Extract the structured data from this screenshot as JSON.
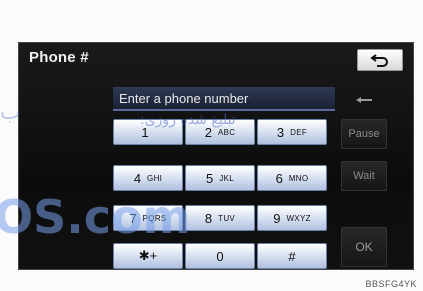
{
  "screen": {
    "title": "Phone #",
    "back_icon": "return-arrow-icon",
    "display_placeholder": "Enter a phone number",
    "backspace_icon": "backspace-arrow-icon"
  },
  "keypad": {
    "keys": [
      {
        "digit": "1",
        "letters": ""
      },
      {
        "digit": "2",
        "letters": "ABC"
      },
      {
        "digit": "3",
        "letters": "DEF"
      },
      {
        "digit": "4",
        "letters": "GHI"
      },
      {
        "digit": "5",
        "letters": "JKL"
      },
      {
        "digit": "6",
        "letters": "MNO"
      },
      {
        "digit": "7",
        "letters": "PQRS"
      },
      {
        "digit": "8",
        "letters": "TUV"
      },
      {
        "digit": "9",
        "letters": "WXYZ"
      },
      {
        "digit": "✱+",
        "letters": ""
      },
      {
        "digit": "0",
        "letters": ""
      },
      {
        "digit": "#",
        "letters": ""
      }
    ]
  },
  "side_buttons": {
    "pause": "Pause",
    "wait": "Wait",
    "ok": "OK"
  },
  "watermark": {
    "mid_persian": "تبلیغ شده روزی:",
    "mid_left": "ب",
    "big": "OS.com"
  },
  "image_code": "BBSFG4YK"
}
